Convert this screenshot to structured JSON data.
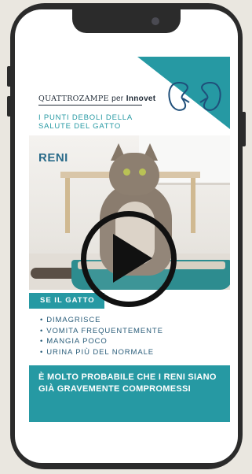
{
  "brand": {
    "part1": "QUATTROZAMPE",
    "part2": "per",
    "part3": "Innovet"
  },
  "subtitle": {
    "line1": "I PUNTI DEBOLI DELLA",
    "line2": "SALUTE DEL GATTO"
  },
  "heading": "RENI",
  "section_tag": "SE IL  GATTO",
  "symptoms": [
    "DIMAGRISCE",
    "VOMITA FREQUENTEMENTE",
    "MANGIA POCO",
    "URINA PIÙ DEL NORMALE"
  ],
  "conclusion": "È MOLTO PROBABILE CHE I RENI SIANO GIÀ GRAVEMENTE COMPROMESSI",
  "colors": {
    "teal": "#2699a3",
    "navy": "#2a6b8a",
    "phone": "#2b2b2b",
    "background": "#eae7e0"
  },
  "icons": {
    "play": "play-icon",
    "kidneys": "kidney-icon"
  }
}
